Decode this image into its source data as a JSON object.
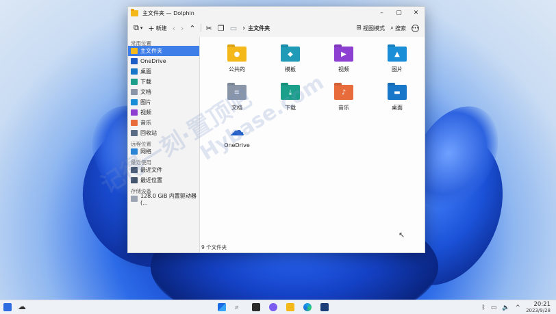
{
  "window": {
    "title": "主文件夹 — Dolphin",
    "controls": [
      "–",
      "▢",
      "✕"
    ]
  },
  "toolbar": {
    "new_label": "新建",
    "breadcrumb": "主文件夹",
    "view_mode_label": "视图模式",
    "search_label": "搜索"
  },
  "sidebar": {
    "sections": {
      "places": "常用位置",
      "remote": "远程位置",
      "recent": "最近使用",
      "devices": "存储设备"
    },
    "places": [
      {
        "label": "主文件夹",
        "selected": true,
        "color": "#f4b81a"
      },
      {
        "label": "OneDrive",
        "color": "#1c5cc7"
      },
      {
        "label": "桌面",
        "color": "#1877c9"
      },
      {
        "label": "下载",
        "color": "#1aa08a"
      },
      {
        "label": "文档",
        "color": "#8a96a8"
      },
      {
        "label": "图片",
        "color": "#1a8fd8"
      },
      {
        "label": "视频",
        "color": "#8c3fd1"
      },
      {
        "label": "音乐",
        "color": "#e86b3c"
      },
      {
        "label": "回收站",
        "color": "#5a6b85"
      }
    ],
    "remote": [
      {
        "label": "网络",
        "color": "#2a84d6"
      }
    ],
    "recent": [
      {
        "label": "最近文件",
        "color": "#44556b"
      },
      {
        "label": "最近位置",
        "color": "#44556b"
      }
    ],
    "devices": [
      {
        "label": "128.0 GiB 内置驱动器 (...",
        "color": "#9aa4b2"
      }
    ]
  },
  "files": [
    {
      "label": "公共的",
      "color": "#f4b81a",
      "icon": "person"
    },
    {
      "label": "模板",
      "color": "#1f9bb8",
      "icon": "template"
    },
    {
      "label": "视频",
      "color": "#8c3fd1",
      "icon": "video"
    },
    {
      "label": "图片",
      "color": "#1a8fd8",
      "icon": "picture"
    },
    {
      "label": "文档",
      "color": "#8a96a8",
      "icon": "document"
    },
    {
      "label": "下载",
      "color": "#1aa08a",
      "icon": "download"
    },
    {
      "label": "音乐",
      "color": "#e86b3c",
      "icon": "music"
    },
    {
      "label": "桌面",
      "color": "#1877c9",
      "icon": "desktop"
    },
    {
      "label": "OneDrive",
      "color": "#1c5cc7",
      "icon": "cloud"
    }
  ],
  "status": "9 个文件夹",
  "watermark": {
    "line1": "记得一刻·置顶吧",
    "line2": "Hybase.com"
  },
  "taskbar": {
    "time": "20:21",
    "date": "2023/9/28",
    "tray_chevron": "^"
  }
}
